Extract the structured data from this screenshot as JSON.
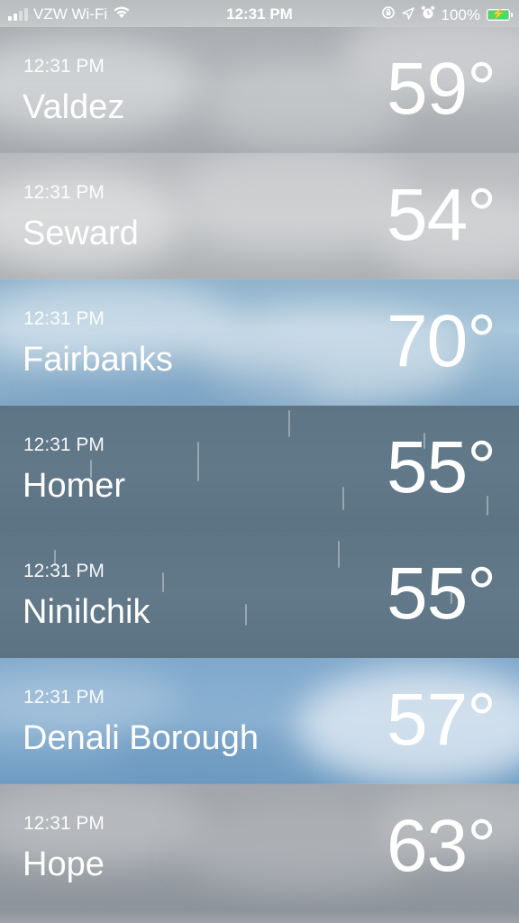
{
  "status_bar": {
    "carrier": "VZW Wi-Fi",
    "time": "12:31 PM",
    "battery": "100%",
    "battery_level": 1.0,
    "icons": [
      "signal-icon",
      "wifi-icon",
      "orientation-lock-icon",
      "location-icon",
      "alarm-icon",
      "battery-charging-icon"
    ]
  },
  "locations": [
    {
      "time": "12:31 PM",
      "city": "Valdez",
      "temp": "59°",
      "condition": "cloudy"
    },
    {
      "time": "12:31 PM",
      "city": "Seward",
      "temp": "54°",
      "condition": "cloudy"
    },
    {
      "time": "12:31 PM",
      "city": "Fairbanks",
      "temp": "70°",
      "condition": "partly-cloudy"
    },
    {
      "time": "12:31 PM",
      "city": "Homer",
      "temp": "55°",
      "condition": "rain"
    },
    {
      "time": "12:31 PM",
      "city": "Ninilchik",
      "temp": "55°",
      "condition": "rain"
    },
    {
      "time": "12:31 PM",
      "city": "Denali Borough",
      "temp": "57°",
      "condition": "partly-cloudy"
    },
    {
      "time": "12:31 PM",
      "city": "Hope",
      "temp": "63°",
      "condition": "cloudy"
    }
  ]
}
